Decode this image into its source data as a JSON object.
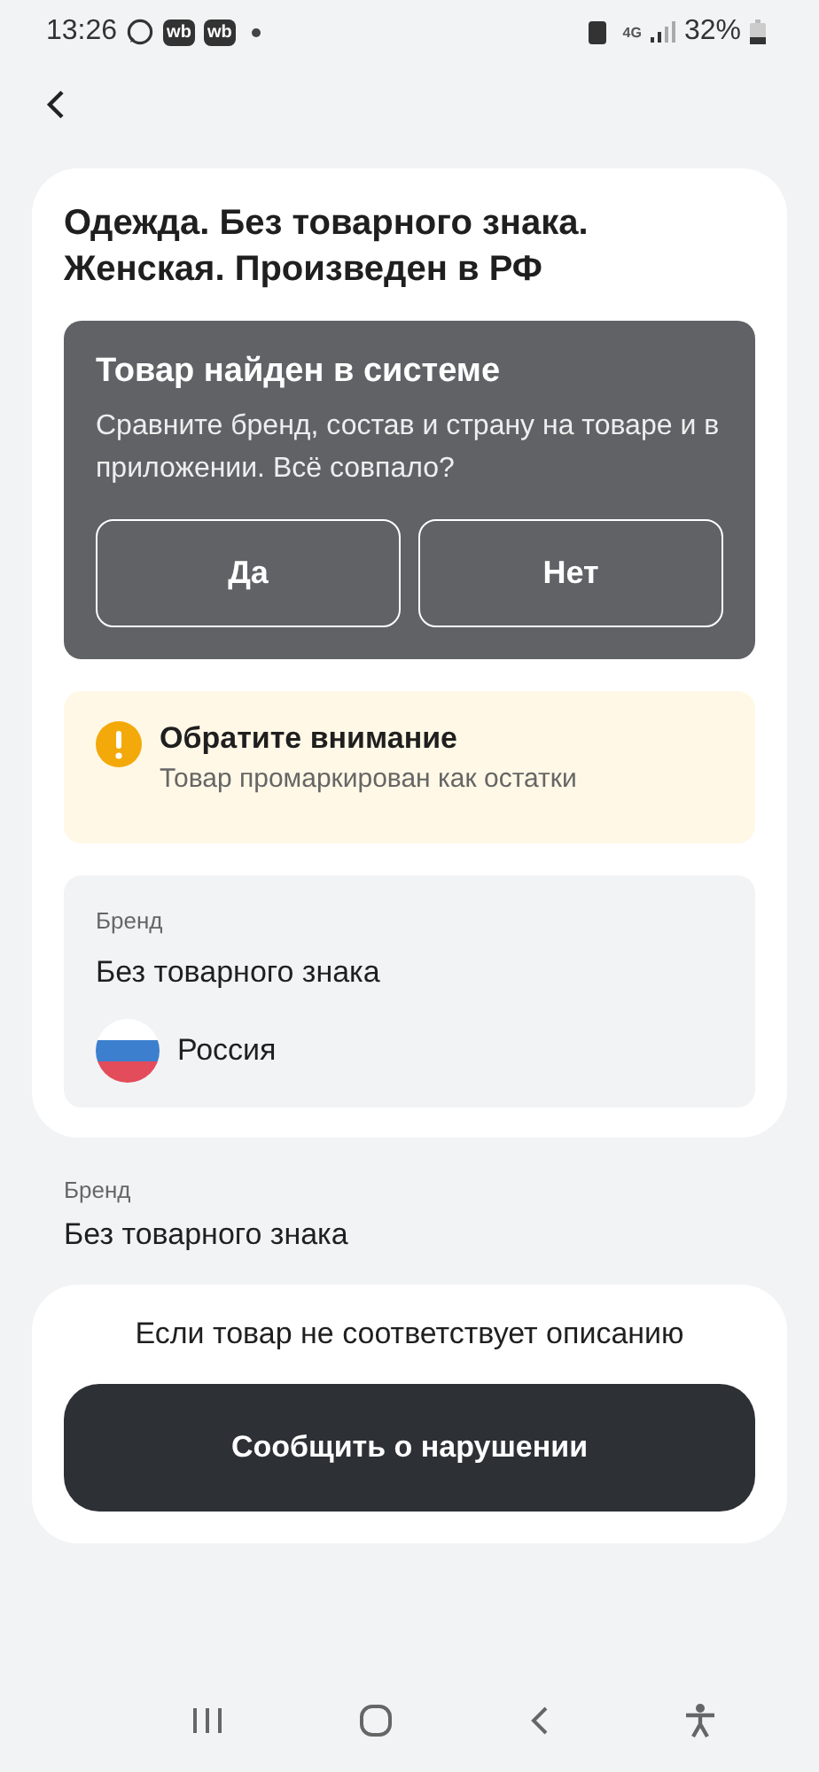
{
  "status_bar": {
    "time": "13:26",
    "app_badges": [
      "wb",
      "wb"
    ],
    "network": "4G",
    "battery": "32%"
  },
  "title": "Одежда. Без товарного знака. Женская. Произведен в РФ",
  "found_panel": {
    "title": "Товар найден в системе",
    "text": "Сравните бренд, состав и страну на товаре и в приложении. Всё совпало?",
    "buttons": [
      "Да",
      "Нет"
    ]
  },
  "notice": {
    "title": "Обратите внимание",
    "text": "Товар промаркирован как остатки"
  },
  "info": {
    "label": "Бренд",
    "value": "Без товарного знака",
    "country": "Россия"
  },
  "brand": {
    "label": "Бренд",
    "value": "Без товарного знака"
  },
  "report": {
    "text": "Если товар не соответствует описанию",
    "button": "Сообщить о нарушении"
  }
}
